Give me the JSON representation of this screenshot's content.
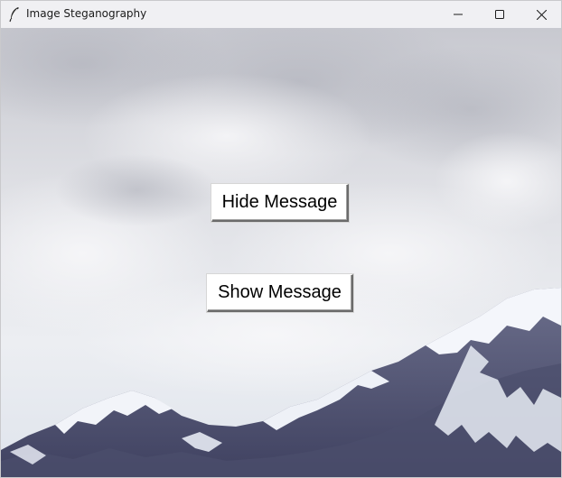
{
  "window": {
    "title": "Image Steganography",
    "controls": {
      "minimize": "minimize-icon",
      "maximize": "maximize-icon",
      "close": "close-icon"
    },
    "app_icon": "feather-icon"
  },
  "main": {
    "background": "snowy-mountain-landscape-image",
    "buttons": [
      {
        "label": "Hide Message"
      },
      {
        "label": "Show Message"
      }
    ]
  },
  "colors": {
    "titlebar": "#f0f0f3",
    "button_bg": "#ffffff",
    "sky": "#d9dce3",
    "mountain_rock": "#5a5d78",
    "snow": "#f4f6fb"
  }
}
